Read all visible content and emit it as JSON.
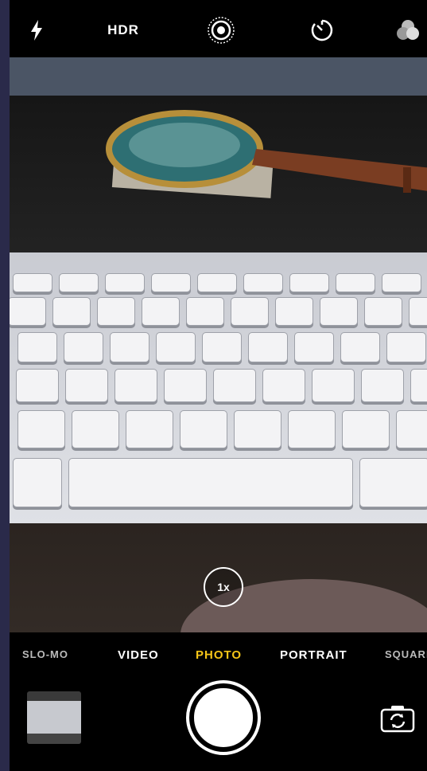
{
  "top_bar": {
    "flash_icon": "flash-icon",
    "hdr_label": "HDR",
    "live_photo_icon": "live-photo-icon",
    "timer_icon": "timer-icon",
    "filters_icon": "filters-icon"
  },
  "viewfinder": {
    "zoom_label": "1x"
  },
  "modes": {
    "items": [
      "SLO-MO",
      "VIDEO",
      "PHOTO",
      "PORTRAIT",
      "SQUARE"
    ],
    "selected": "PHOTO"
  },
  "controls": {
    "thumbnail_icon": "last-photo-thumbnail",
    "shutter_icon": "shutter-icon",
    "flip_icon": "switch-camera-icon"
  },
  "colors": {
    "accent": "#f5c518",
    "background": "#000000"
  }
}
